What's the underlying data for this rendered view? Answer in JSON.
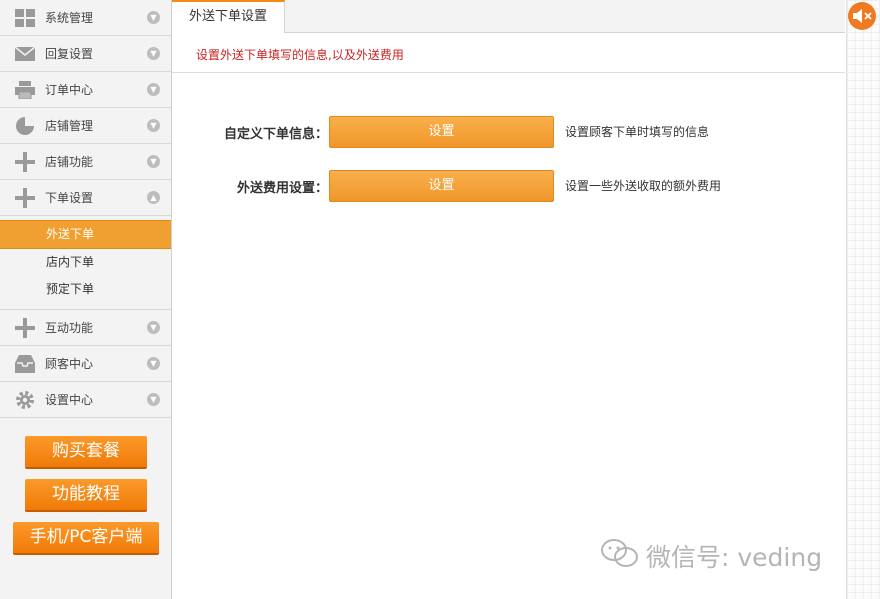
{
  "sidebar": {
    "items": [
      {
        "label": "系统管理",
        "icon": "grid-icon"
      },
      {
        "label": "回复设置",
        "icon": "envelope-icon"
      },
      {
        "label": "订单中心",
        "icon": "printer-icon"
      },
      {
        "label": "店铺管理",
        "icon": "pie-chart-icon"
      },
      {
        "label": "店铺功能",
        "icon": "plus-icon"
      },
      {
        "label": "下单设置",
        "icon": "plus-icon"
      }
    ],
    "sub_items": [
      {
        "label": "外送下单",
        "active": true
      },
      {
        "label": "店内下单",
        "active": false
      },
      {
        "label": "预定下单",
        "active": false
      }
    ],
    "items_after": [
      {
        "label": "互动功能",
        "icon": "plus-icon"
      },
      {
        "label": "顾客中心",
        "icon": "inbox-icon"
      },
      {
        "label": "设置中心",
        "icon": "gear-icon"
      }
    ],
    "buttons": {
      "buy": "购买套餐",
      "tutorial": "功能教程",
      "client": "手机/PC客户端"
    }
  },
  "main": {
    "tab": "外送下单设置",
    "notice": "设置外送下单填写的信息,以及外送费用",
    "rows": [
      {
        "label": "自定义下单信息：",
        "button": "设置",
        "desc": "设置顾客下单时填写的信息"
      },
      {
        "label": "外送费用设置：",
        "button": "设置",
        "desc": "设置一些外送收取的额外费用"
      }
    ]
  },
  "watermark": "微信号: veding",
  "colors": {
    "accent": "#f0a030",
    "notice": "#cc2222"
  }
}
